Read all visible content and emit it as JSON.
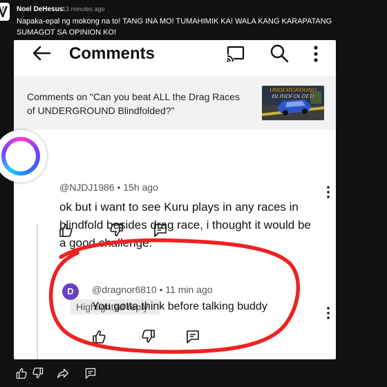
{
  "post": {
    "author": "Noel DeHesus",
    "time": "13 minutes ago",
    "text": "Napaka-epal ng mokong na to! TANG INA MO! TUMAHIMIK KA! WALA KANG KARAPATANG SUMAGOT SA OPINION KO!"
  },
  "screen": {
    "title": "Comments",
    "context_label": "Comments on \"Can you beat ALL the Drag Races of UNDERGROUND Blindfolded?\"",
    "thumbnail": {
      "line1": "UNDERGROUND",
      "line2": "BLINDFOLDED"
    },
    "comment": {
      "handle": "@NJDJ1986 • 15h ago",
      "text": "ok but i want to see Kuru plays in any races in blindfold besides drag race, i thought it would be a good challenge."
    },
    "highlighted_label": "Highlighted reply",
    "reply": {
      "avatar_letter": "D",
      "handle": "@dragnor6810 • 11 min ago",
      "text": "You gotta think before talking buddy"
    }
  },
  "colors": {
    "background": "#111111",
    "card": "#ffffff",
    "reply_avatar": "#6a3fc4",
    "annotation": "#ee2222"
  },
  "icons": [
    "back-arrow-icon",
    "cast-icon",
    "search-icon",
    "more-vert-icon",
    "thumb-up-icon",
    "thumb-down-icon",
    "reply-icon",
    "share-icon"
  ]
}
